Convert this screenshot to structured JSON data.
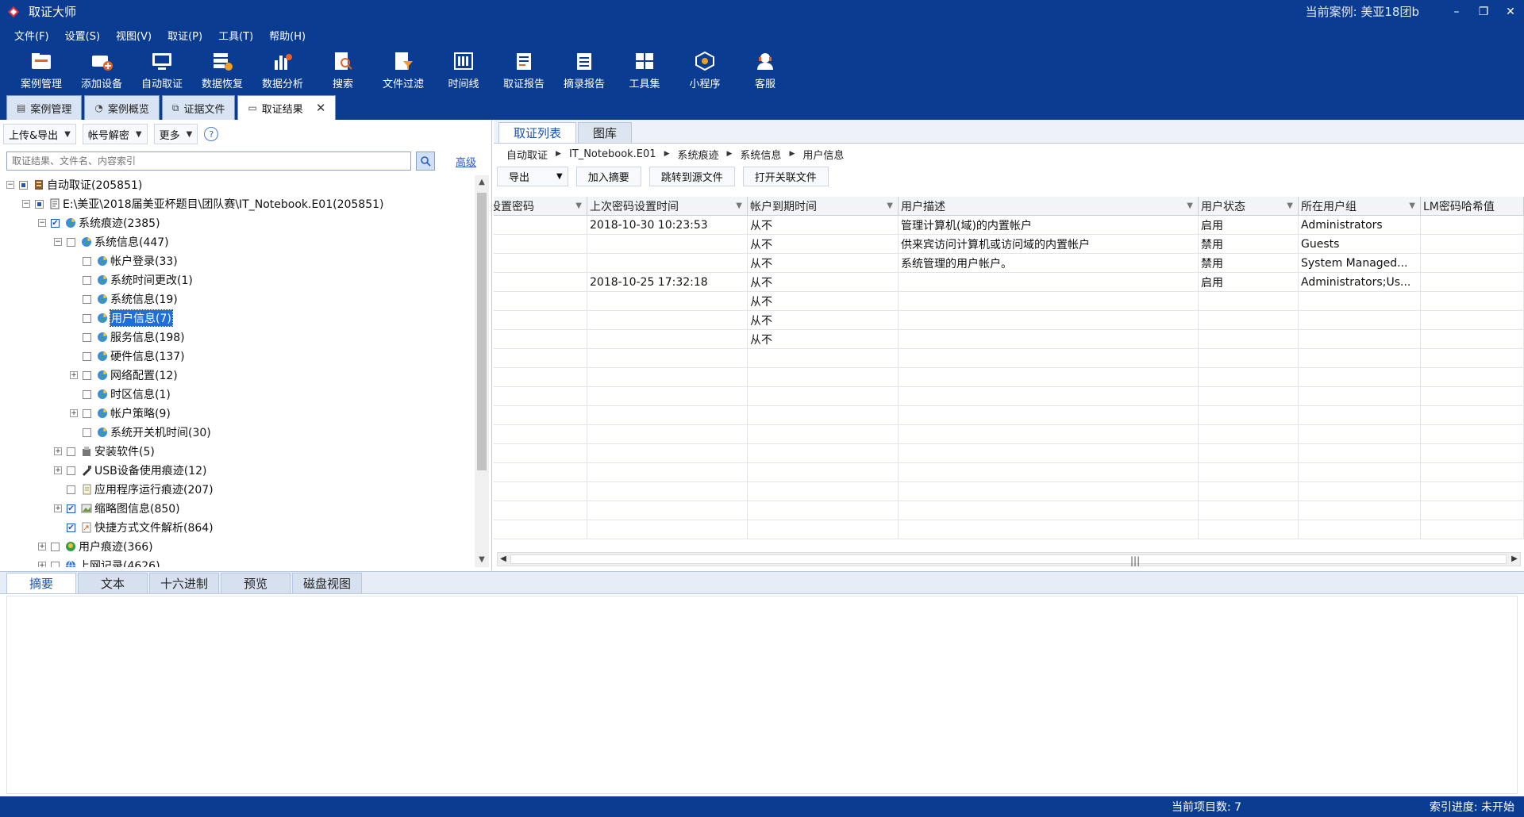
{
  "window": {
    "title": "取证大师",
    "current_case": "当前案例:  美亚18团b",
    "minimize": "–",
    "restore": "❐",
    "close": "✕"
  },
  "menu": [
    "文件(F)",
    "设置(S)",
    "视图(V)",
    "取证(P)",
    "工具(T)",
    "帮助(H)"
  ],
  "toolbar": [
    {
      "label": "案例管理",
      "icon": "case-manage-icon"
    },
    {
      "label": "添加设备",
      "icon": "add-device-icon"
    },
    {
      "label": "自动取证",
      "icon": "auto-forensics-icon"
    },
    {
      "label": "数据恢复",
      "icon": "data-recovery-icon"
    },
    {
      "label": "数据分析",
      "icon": "data-analysis-icon"
    },
    {
      "label": "搜索",
      "icon": "search-icon"
    },
    {
      "label": "文件过滤",
      "icon": "file-filter-icon"
    },
    {
      "label": "时间线",
      "icon": "timeline-icon"
    },
    {
      "label": "取证报告",
      "icon": "report-icon"
    },
    {
      "label": "摘录报告",
      "icon": "excerpt-report-icon"
    },
    {
      "label": "工具集",
      "icon": "toolset-icon"
    },
    {
      "label": "小程序",
      "icon": "mini-program-icon"
    },
    {
      "label": "客服",
      "icon": "customer-service-icon"
    }
  ],
  "doc_tabs": [
    {
      "label": "案例管理",
      "active": false
    },
    {
      "label": "案例概览",
      "active": false
    },
    {
      "label": "证据文件",
      "active": false
    },
    {
      "label": "取证结果",
      "active": true,
      "close": "✕"
    }
  ],
  "left": {
    "upload_export": "上传&导出",
    "account_decrypt": "帐号解密",
    "more": "更多",
    "help": "?",
    "search_placeholder": "取证结果、文件名、内容索引",
    "advanced": "高级",
    "tree": [
      {
        "label": "自动取证(205851)",
        "depth": 0,
        "expander": "−",
        "check": "partial",
        "icon": "case-root-icon"
      },
      {
        "label": "E:\\美亚\\2018届美亚杯题目\\团队赛\\IT_Notebook.E01(205851)",
        "depth": 1,
        "expander": "−",
        "check": "partial",
        "icon": "disk-image-icon"
      },
      {
        "label": "系统痕迹(2385)",
        "depth": 2,
        "expander": "−",
        "check": "checked",
        "icon": "globe-icon"
      },
      {
        "label": "系统信息(447)",
        "depth": 3,
        "expander": "−",
        "check": "none",
        "icon": "globe-icon"
      },
      {
        "label": "帐户登录(33)",
        "depth": 4,
        "expander": "",
        "check": "none",
        "icon": "globe-icon"
      },
      {
        "label": "系统时间更改(1)",
        "depth": 4,
        "expander": "",
        "check": "none",
        "icon": "globe-icon"
      },
      {
        "label": "系统信息(19)",
        "depth": 4,
        "expander": "",
        "check": "none",
        "icon": "globe-icon"
      },
      {
        "label": "用户信息(7)",
        "depth": 4,
        "expander": "",
        "check": "none",
        "icon": "globe-icon",
        "selected": true
      },
      {
        "label": "服务信息(198)",
        "depth": 4,
        "expander": "",
        "check": "none",
        "icon": "globe-icon"
      },
      {
        "label": "硬件信息(137)",
        "depth": 4,
        "expander": "",
        "check": "none",
        "icon": "globe-icon"
      },
      {
        "label": "网络配置(12)",
        "depth": 4,
        "expander": "+",
        "check": "none",
        "icon": "globe-icon"
      },
      {
        "label": "时区信息(1)",
        "depth": 4,
        "expander": "",
        "check": "none",
        "icon": "globe-icon"
      },
      {
        "label": "帐户策略(9)",
        "depth": 4,
        "expander": "+",
        "check": "none",
        "icon": "globe-icon"
      },
      {
        "label": "系统开关机时间(30)",
        "depth": 4,
        "expander": "",
        "check": "none",
        "icon": "globe-icon"
      },
      {
        "label": "安装软件(5)",
        "depth": 3,
        "expander": "+",
        "check": "none",
        "icon": "installer-icon"
      },
      {
        "label": "USB设备使用痕迹(12)",
        "depth": 3,
        "expander": "+",
        "check": "none",
        "icon": "usb-icon"
      },
      {
        "label": "应用程序运行痕迹(207)",
        "depth": 3,
        "expander": "",
        "check": "none",
        "icon": "app-run-icon"
      },
      {
        "label": "缩略图信息(850)",
        "depth": 3,
        "expander": "+",
        "check": "checked",
        "icon": "thumbnail-icon"
      },
      {
        "label": "快捷方式文件解析(864)",
        "depth": 3,
        "expander": "",
        "check": "checked",
        "icon": "shortcut-icon"
      },
      {
        "label": "用户痕迹(366)",
        "depth": 2,
        "expander": "+",
        "check": "none",
        "icon": "user-trace-icon"
      },
      {
        "label": "上网记录(4626)",
        "depth": 2,
        "expander": "+",
        "check": "none",
        "icon": "web-history-icon"
      }
    ]
  },
  "right": {
    "tabs": [
      {
        "label": "取证列表",
        "active": true
      },
      {
        "label": "图库",
        "active": false
      }
    ],
    "breadcrumb": [
      "自动取证",
      "IT_Notebook.E01",
      "系统痕迹",
      "系统信息",
      "用户信息"
    ],
    "actions": {
      "export": "导出",
      "add_excerpt": "加入摘要",
      "jump_source": "跳转到源文件",
      "open_related": "打开关联文件"
    },
    "columns": [
      "设置密码",
      "上次密码设置时间",
      "帐户到期时间",
      "用户描述",
      "用户状态",
      "所在用户组",
      "LM密码哈希值"
    ],
    "rows": [
      [
        "",
        "2018-10-30 10:23:53",
        "从不",
        "管理计算机(域)的内置帐户",
        "启用",
        "Administrators",
        ""
      ],
      [
        "",
        "",
        "从不",
        "供来宾访问计算机或访问域的内置帐户",
        "禁用",
        "Guests",
        ""
      ],
      [
        "",
        "",
        "从不",
        "系统管理的用户帐户。",
        "禁用",
        "System Managed...",
        ""
      ],
      [
        "",
        "2018-10-25 17:32:18",
        "从不",
        "",
        "启用",
        "Administrators;Us...",
        ""
      ],
      [
        "",
        "",
        "从不",
        "",
        "",
        "",
        ""
      ],
      [
        "",
        "",
        "从不",
        "",
        "",
        "",
        ""
      ],
      [
        "",
        "",
        "从不",
        "",
        "",
        "",
        ""
      ]
    ]
  },
  "bottom_tabs": [
    {
      "label": "摘要",
      "active": true
    },
    {
      "label": "文本",
      "active": false
    },
    {
      "label": "十六进制",
      "active": false
    },
    {
      "label": "预览",
      "active": false
    },
    {
      "label": "磁盘视图",
      "active": false
    }
  ],
  "status": {
    "item_count": "当前项目数: 7",
    "index_progress": "索引进度: 未开始"
  },
  "colors": {
    "chrome_blue": "#0a3d91",
    "selection": "#1e6fd9",
    "case_text": "#dfe9ff"
  }
}
